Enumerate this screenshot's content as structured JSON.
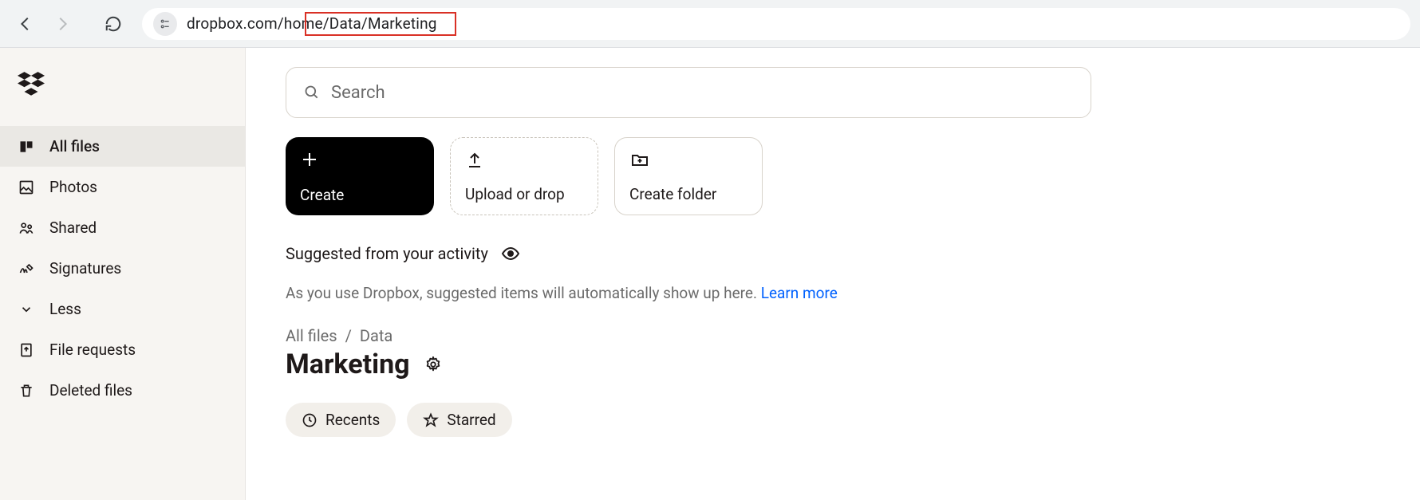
{
  "browser": {
    "url": "dropbox.com/home/Data/Marketing"
  },
  "sidebar": {
    "items": [
      {
        "label": "All files"
      },
      {
        "label": "Photos"
      },
      {
        "label": "Shared"
      },
      {
        "label": "Signatures"
      },
      {
        "label": "Less"
      },
      {
        "label": "File requests"
      },
      {
        "label": "Deleted files"
      }
    ]
  },
  "search": {
    "placeholder": "Search"
  },
  "actions": {
    "create": "Create",
    "upload": "Upload or drop",
    "folder": "Create folder"
  },
  "suggested": {
    "heading": "Suggested from your activity",
    "text": "As you use Dropbox, suggested items will automatically show up here. ",
    "learn_more": "Learn more"
  },
  "breadcrumb": {
    "items": [
      "All files",
      "Data"
    ],
    "sep": "/"
  },
  "page": {
    "title": "Marketing"
  },
  "chips": {
    "recents": "Recents",
    "starred": "Starred"
  }
}
